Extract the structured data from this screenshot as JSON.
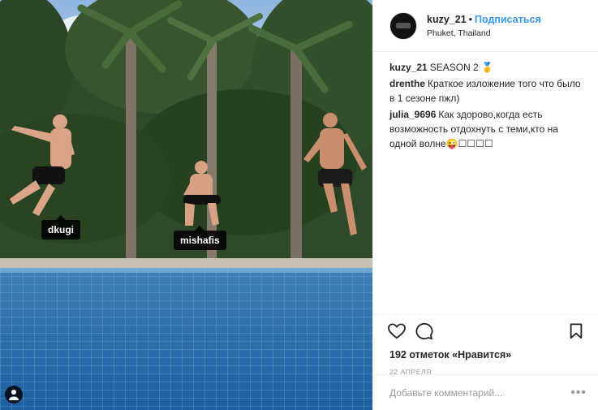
{
  "photo": {
    "tags": [
      "dkugi",
      "mishafis"
    ]
  },
  "header": {
    "username": "kuzy_21",
    "separator": "•",
    "follow_label": "Подписаться",
    "location": "Phuket, Thailand"
  },
  "comments": [
    {
      "user": "kuzy_21",
      "text": "SEASON 2 🥇"
    },
    {
      "user": "drenthe",
      "text": "Краткое изложение того что было в 1 сезоне пжл)"
    },
    {
      "user": "julia_9696",
      "text": "Как здорово,когда есть возможность отдохнуть с теми,кто на одной волне😜☐☐☐☐"
    }
  ],
  "actions": {
    "likes": "192 отметок «Нравится»",
    "date": "22 АПРЕЛЯ"
  },
  "add_comment": {
    "placeholder": "Добавьте комментарий...",
    "more": "•••"
  },
  "icons": {
    "like": "heart-icon",
    "comment": "comment-bubble-icon",
    "save": "bookmark-icon",
    "user_tag": "person-icon"
  }
}
